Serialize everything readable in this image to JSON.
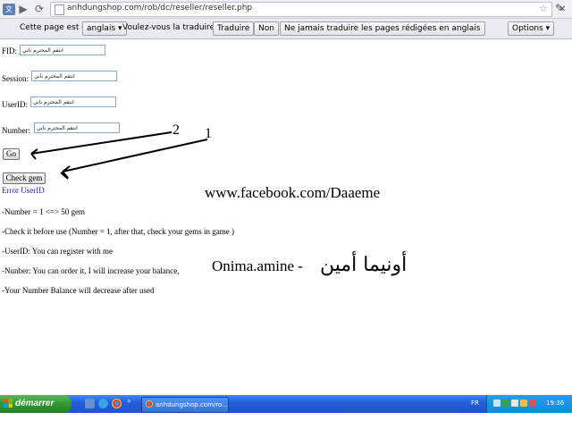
{
  "browser": {
    "url": "anhdungshop.com/rob/dc/reseller/reseller.php"
  },
  "translate_bar": {
    "prompt": "Cette page est en",
    "language": "anglais",
    "question": "Voulez-vous la traduire ?",
    "translate_label": "Traduire",
    "no_label": "Non",
    "never_label": "Ne jamais traduire les pages rédigées en anglais",
    "options_label": "Options"
  },
  "form": {
    "fid_label": "FID:",
    "session_label": "Session:",
    "userid_label": "UserID:",
    "number_label": "Number:",
    "field_value": "انتقم المحترم ناني",
    "go_label": "Go",
    "check_gem_label": "Check gem",
    "error_text": "Error UserID"
  },
  "info_lines": [
    "-Number = 1 <=> 50 gem",
    "-Check it before use (Number = 1, after that, check your gems in game )",
    "-UserID: You can register with me",
    "-Nunber: You can order it, I will increase your balance,",
    "-Your Number Balance will decrease after used"
  ],
  "overlay": {
    "facebook": "www.facebook.com/Daaeme",
    "onima": "Onima.amine -",
    "arabic": "أونيما أمين",
    "mark1": "1",
    "mark2": "2"
  },
  "taskbar": {
    "start_label": "démarrer",
    "task_label": "anhdungshop.com/ro...",
    "lang": "FR",
    "clock": "19:36"
  }
}
